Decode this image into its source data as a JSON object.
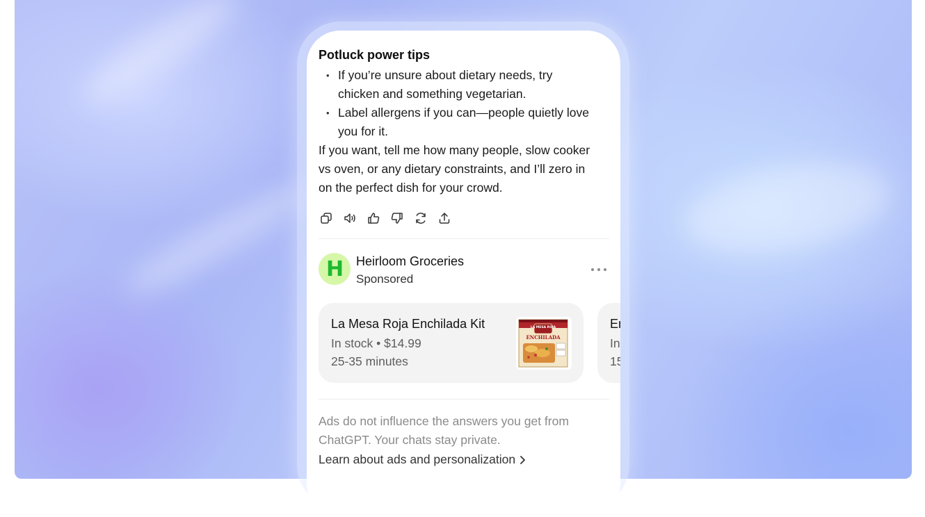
{
  "tips": {
    "title": "Potluck power tips",
    "bullets": [
      "If you’re unsure about dietary needs, try chicken and something vegetarian.",
      "Label allergens if you can—people quietly love you for it."
    ],
    "paragraph": "If you want, tell me how many people, slow cooker vs oven, or any dietary constraints, and I’ll zero in on the perfect dish for your crowd."
  },
  "actions": [
    "copy-icon",
    "read-aloud-icon",
    "thumbs-up-icon",
    "thumbs-down-icon",
    "regenerate-icon",
    "share-icon"
  ],
  "sponsor": {
    "logo_letter": "H",
    "name": "Heirloom Groceries",
    "label": "Sponsored",
    "logo_bg": "#d6f7a8",
    "logo_color": "#1fb92f"
  },
  "products": [
    {
      "title": "La Mesa Roja Enchilada Kit",
      "stock": "In stock • $14.99",
      "time": "25-35 minutes",
      "image_brand": "LA MESA ROJA",
      "image_text": "ENCHILADA"
    },
    {
      "title": "En",
      "stock": "In",
      "time": "15"
    }
  ],
  "disclaimer": "Ads do not influence the answers you get from ChatGPT. Your chats stay private.",
  "learn_link": "Learn about ads and personalization"
}
